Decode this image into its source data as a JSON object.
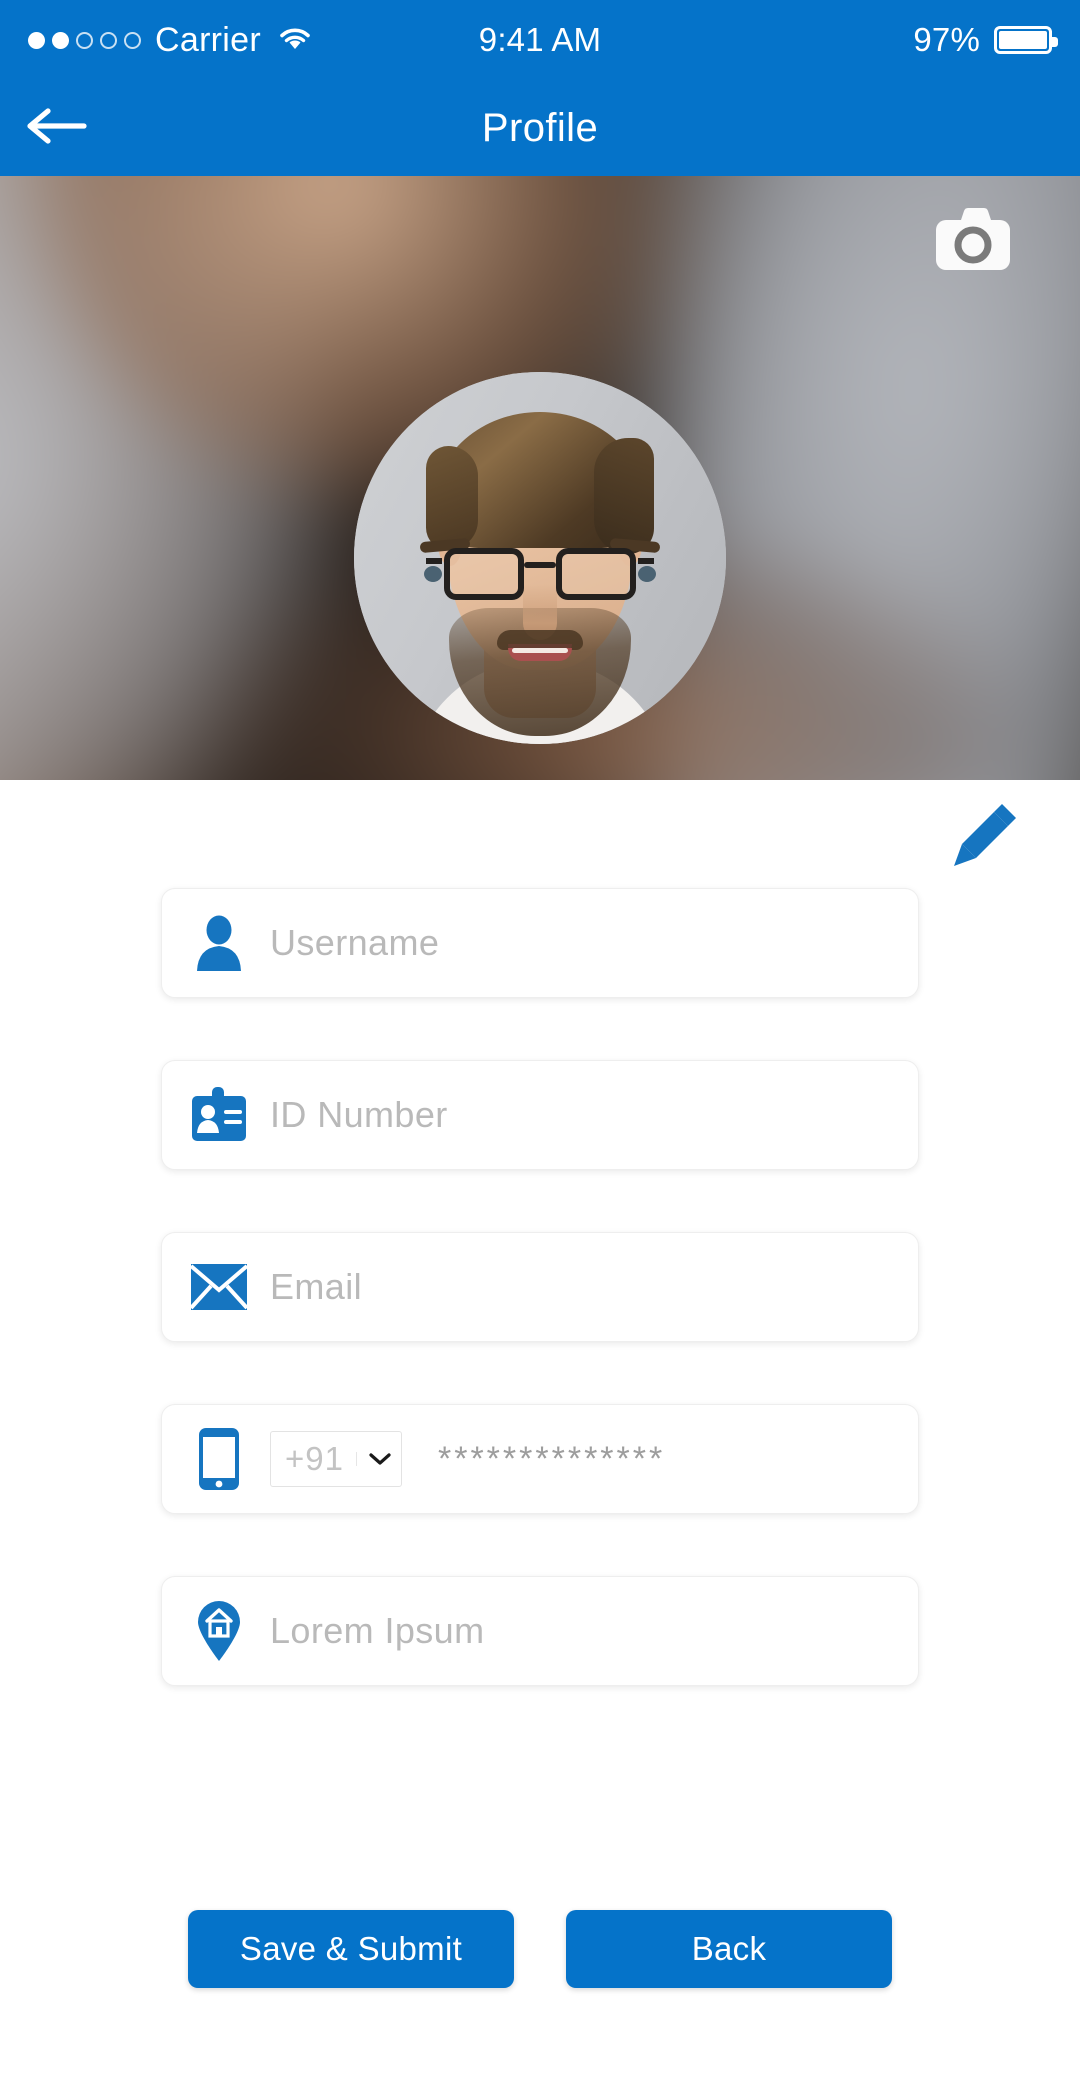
{
  "status_bar": {
    "signal_dots": [
      "filled",
      "filled",
      "empty",
      "empty",
      "empty"
    ],
    "carrier": "Carrier",
    "wifi_icon": "wifi-icon",
    "time": "9:41 AM",
    "battery_percent": "97%",
    "battery_level": 97
  },
  "nav": {
    "back_icon": "arrow-left-icon",
    "title": "Profile"
  },
  "banner": {
    "camera_icon": "camera-icon",
    "avatar_alt": "profile-photo"
  },
  "form": {
    "edit_icon": "pencil-icon",
    "fields": [
      {
        "icon": "person-icon",
        "name": "username",
        "placeholder": "Username",
        "value": ""
      },
      {
        "icon": "id-card-icon",
        "name": "id-number",
        "placeholder": "ID Number",
        "value": ""
      },
      {
        "icon": "envelope-icon",
        "name": "email",
        "placeholder": "Email",
        "value": ""
      },
      {
        "icon": "phone-icon",
        "name": "phone",
        "placeholder": "",
        "value": "**************"
      },
      {
        "icon": "home-pin-icon",
        "name": "address",
        "placeholder": "Lorem Ipsum",
        "value": ""
      }
    ],
    "country_code": {
      "selected": "+91",
      "caret_icon": "chevron-down-icon"
    }
  },
  "actions": {
    "save_label": "Save & Submit",
    "back_label": "Back"
  },
  "colors": {
    "brand_blue": "#0573c9",
    "placeholder_gray": "#b9b9b9",
    "field_border": "#eeeeee",
    "page_background": "#ffffff"
  }
}
